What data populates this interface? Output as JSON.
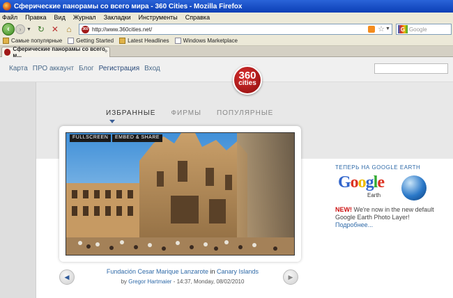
{
  "window": {
    "title": "Сферические панорамы со всего мира - 360 Cities - Mozilla Firefox"
  },
  "menubar": [
    "Файл",
    "Правка",
    "Вид",
    "Журнал",
    "Закладки",
    "Инструменты",
    "Справка"
  ],
  "navbar": {
    "url": "http://www.360cities.net/",
    "search_placeholder": "Google"
  },
  "bookmarks": [
    {
      "label": "Самые популярные",
      "icon": "folder-icon"
    },
    {
      "label": "Getting Started",
      "icon": "page-icon"
    },
    {
      "label": "Latest Headlines",
      "icon": "rss-folder-icon"
    },
    {
      "label": "Windows Marketplace",
      "icon": "page-icon"
    }
  ],
  "tab": {
    "label": "Сферические панорамы со всего м..."
  },
  "site": {
    "nav": [
      {
        "label": "Карта"
      },
      {
        "label": "ПРО аккаунт"
      },
      {
        "label": "Блог"
      },
      {
        "label": "Регистрация"
      },
      {
        "label": "Вход"
      }
    ],
    "logo_line1": "360",
    "logo_line2": "cities",
    "categories": [
      {
        "label": "ИЗБРАННЫЕ",
        "active": true
      },
      {
        "label": "ФИРМЫ",
        "active": false
      },
      {
        "label": "ПОПУЛЯРНЫЕ",
        "active": false
      }
    ],
    "pano_buttons": {
      "fullscreen": "FULLSCREEN",
      "embed": "EMBED & SHARE"
    },
    "pano": {
      "title_name": "Fundación Cesar Marique Lanzarote",
      "title_in": " in ",
      "title_place": "Canary Islands",
      "by": "by ",
      "author": "Gregor Hartmaier",
      "meta": " - 14:37, Monday, 08/02/2010"
    },
    "google_earth": {
      "heading": "ТЕПЕРЬ НА GOOGLE EARTH",
      "logo_word": "Google",
      "logo_sub": "Earth",
      "new_label": "NEW!",
      "text": " We're now in the new default Google Earth Photo Layer!",
      "more": "Подробнее..."
    }
  },
  "colors": {
    "titlebar": "#0b3fb5",
    "chrome": "#ece9d8",
    "link": "#2f6aa8",
    "logo_red": "#a01818"
  }
}
